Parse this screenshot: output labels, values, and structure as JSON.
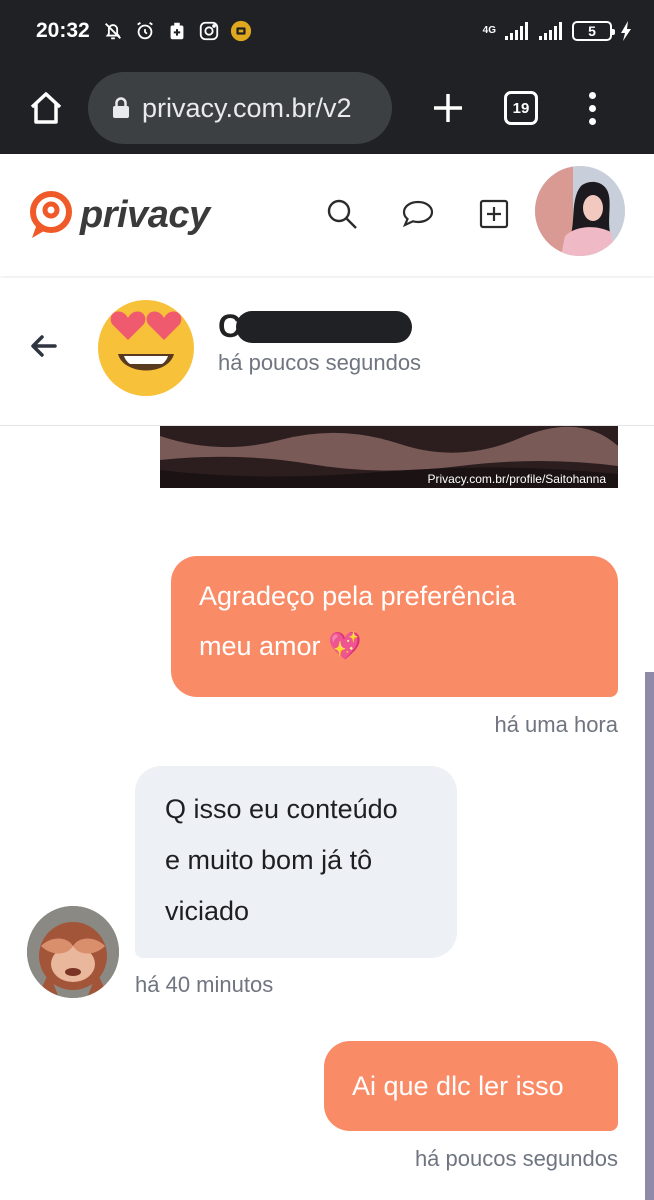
{
  "status_bar": {
    "time": "20:32",
    "network": "4G",
    "battery": "5"
  },
  "browser": {
    "url": "privacy.com.br/v2",
    "tab_count": "19"
  },
  "site": {
    "logo_text": "privacy",
    "brand_color": "#f05a28"
  },
  "chat_header": {
    "name_initial": "C",
    "last_seen": "há poucos segundos"
  },
  "chat": {
    "media_watermark": "Privacy.com.br/profile/Saitohanna",
    "messages": [
      {
        "direction": "out",
        "lines": [
          "Agradeço pela preferência",
          "meu amor 💖"
        ],
        "time": "há uma hora"
      },
      {
        "direction": "in",
        "lines": [
          "Q isso eu conteúdo",
          "e muito bom já tô",
          "viciado"
        ],
        "time": "há 40 minutos"
      },
      {
        "direction": "out",
        "lines": [
          "Ai que dlc ler isso"
        ],
        "time": "há poucos segundos"
      }
    ]
  },
  "colors": {
    "outgoing_bubble": "#fa8b67",
    "incoming_bubble": "#edf0f4",
    "chrome_bar": "#202124"
  }
}
